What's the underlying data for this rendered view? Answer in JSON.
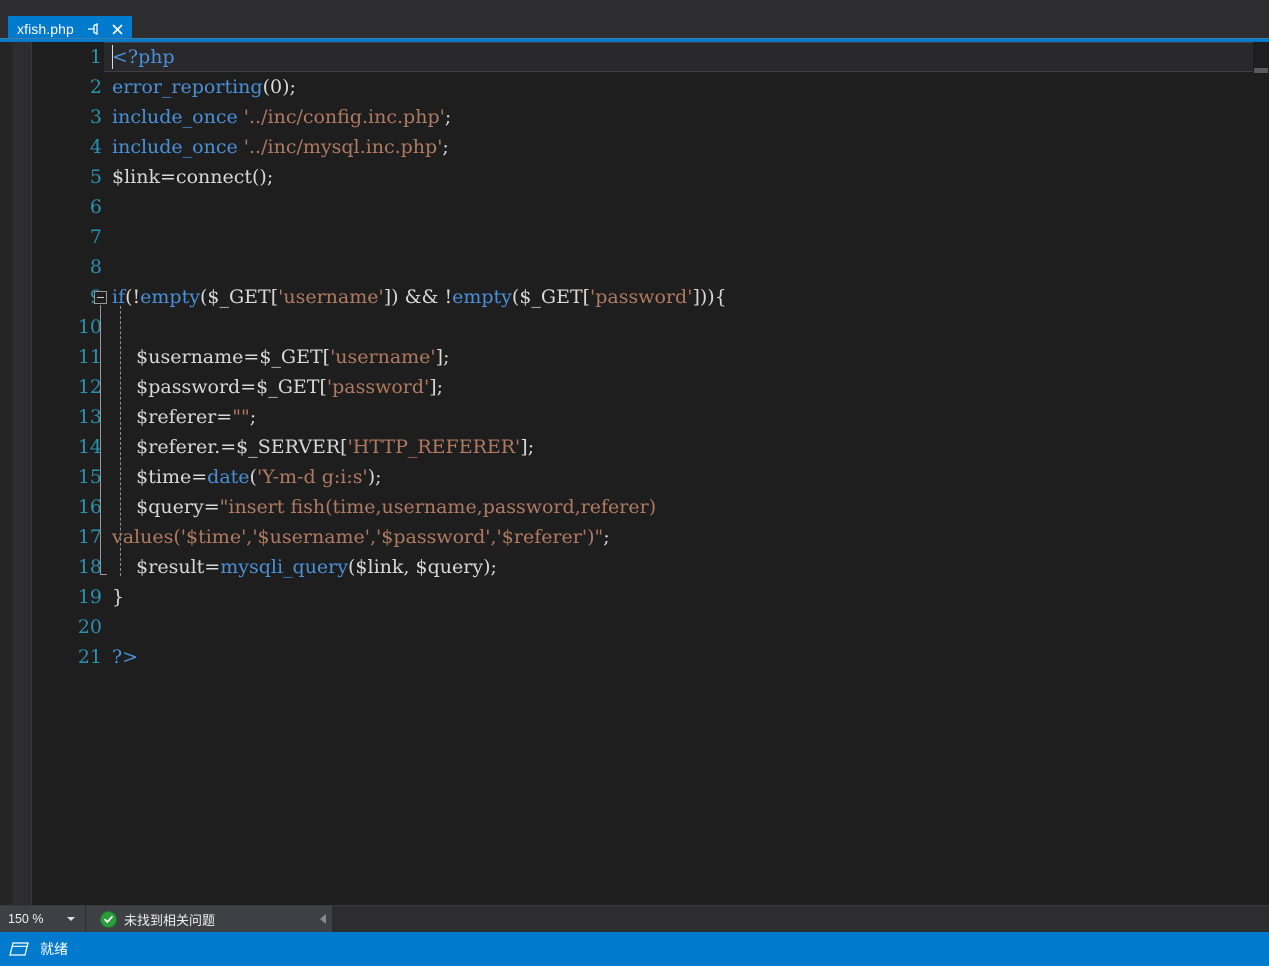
{
  "tab": {
    "title": "xfish.php",
    "pin_icon": "pin-icon",
    "close_icon": "close-icon"
  },
  "editor": {
    "caret_line": 1,
    "current_line": 1,
    "lines": [
      {
        "n": "1",
        "tokens": [
          {
            "t": "kw",
            "s": "<?php"
          }
        ]
      },
      {
        "n": "2",
        "tokens": [
          {
            "t": "fn",
            "s": "error_reporting"
          },
          {
            "t": "punc",
            "s": "("
          },
          {
            "t": "num",
            "s": "0"
          },
          {
            "t": "punc",
            "s": ");"
          }
        ]
      },
      {
        "n": "3",
        "tokens": [
          {
            "t": "fn",
            "s": "include_once"
          },
          {
            "t": "plain",
            "s": " "
          },
          {
            "t": "str",
            "s": "'../inc/config.inc.php'"
          },
          {
            "t": "punc",
            "s": ";"
          }
        ]
      },
      {
        "n": "4",
        "tokens": [
          {
            "t": "fn",
            "s": "include_once"
          },
          {
            "t": "plain",
            "s": " "
          },
          {
            "t": "str",
            "s": "'../inc/mysql.inc.php'"
          },
          {
            "t": "punc",
            "s": ";"
          }
        ]
      },
      {
        "n": "5",
        "tokens": [
          {
            "t": "var",
            "s": "$link"
          },
          {
            "t": "punc",
            "s": "="
          },
          {
            "t": "plain",
            "s": "connect"
          },
          {
            "t": "punc",
            "s": "();"
          }
        ]
      },
      {
        "n": "6",
        "tokens": []
      },
      {
        "n": "7",
        "tokens": []
      },
      {
        "n": "8",
        "tokens": []
      },
      {
        "n": "9",
        "tokens": [
          {
            "t": "kw",
            "s": "if"
          },
          {
            "t": "punc",
            "s": "(!"
          },
          {
            "t": "kw",
            "s": "empty"
          },
          {
            "t": "punc",
            "s": "("
          },
          {
            "t": "var",
            "s": "$_GET"
          },
          {
            "t": "punc",
            "s": "["
          },
          {
            "t": "str",
            "s": "'username'"
          },
          {
            "t": "punc",
            "s": "])"
          },
          {
            "t": "plain",
            "s": " && !"
          },
          {
            "t": "kw",
            "s": "empty"
          },
          {
            "t": "punc",
            "s": "("
          },
          {
            "t": "var",
            "s": "$_GET"
          },
          {
            "t": "punc",
            "s": "["
          },
          {
            "t": "str",
            "s": "'password'"
          },
          {
            "t": "punc",
            "s": "])){"
          }
        ]
      },
      {
        "n": "10",
        "tokens": []
      },
      {
        "n": "11",
        "tokens": [
          {
            "t": "plain",
            "s": "    "
          },
          {
            "t": "var",
            "s": "$username"
          },
          {
            "t": "punc",
            "s": "="
          },
          {
            "t": "var",
            "s": "$_GET"
          },
          {
            "t": "punc",
            "s": "["
          },
          {
            "t": "str",
            "s": "'username'"
          },
          {
            "t": "punc",
            "s": "];"
          }
        ]
      },
      {
        "n": "12",
        "tokens": [
          {
            "t": "plain",
            "s": "    "
          },
          {
            "t": "var",
            "s": "$password"
          },
          {
            "t": "punc",
            "s": "="
          },
          {
            "t": "var",
            "s": "$_GET"
          },
          {
            "t": "punc",
            "s": "["
          },
          {
            "t": "str",
            "s": "'password'"
          },
          {
            "t": "punc",
            "s": "];"
          }
        ]
      },
      {
        "n": "13",
        "tokens": [
          {
            "t": "plain",
            "s": "    "
          },
          {
            "t": "var",
            "s": "$referer"
          },
          {
            "t": "punc",
            "s": "="
          },
          {
            "t": "str",
            "s": "\"\""
          },
          {
            "t": "punc",
            "s": ";"
          }
        ]
      },
      {
        "n": "14",
        "tokens": [
          {
            "t": "plain",
            "s": "    "
          },
          {
            "t": "var",
            "s": "$referer"
          },
          {
            "t": "punc",
            "s": ".="
          },
          {
            "t": "var",
            "s": "$_SERVER"
          },
          {
            "t": "punc",
            "s": "["
          },
          {
            "t": "str",
            "s": "'HTTP_REFERER'"
          },
          {
            "t": "punc",
            "s": "];"
          }
        ]
      },
      {
        "n": "15",
        "tokens": [
          {
            "t": "plain",
            "s": "    "
          },
          {
            "t": "var",
            "s": "$time"
          },
          {
            "t": "punc",
            "s": "="
          },
          {
            "t": "fn",
            "s": "date"
          },
          {
            "t": "punc",
            "s": "("
          },
          {
            "t": "str",
            "s": "'Y-m-d g:i:s'"
          },
          {
            "t": "punc",
            "s": ");"
          }
        ]
      },
      {
        "n": "16",
        "tokens": [
          {
            "t": "plain",
            "s": "    "
          },
          {
            "t": "var",
            "s": "$query"
          },
          {
            "t": "punc",
            "s": "="
          },
          {
            "t": "str",
            "s": "\"insert fish(time,username,password,referer)"
          }
        ]
      },
      {
        "n": "17",
        "tokens": [
          {
            "t": "str",
            "s": "values('$time','$username','$password','$referer')\""
          },
          {
            "t": "punc",
            "s": ";"
          }
        ]
      },
      {
        "n": "18",
        "tokens": [
          {
            "t": "plain",
            "s": "    "
          },
          {
            "t": "var",
            "s": "$result"
          },
          {
            "t": "punc",
            "s": "="
          },
          {
            "t": "fn",
            "s": "mysqli_query"
          },
          {
            "t": "punc",
            "s": "("
          },
          {
            "t": "var",
            "s": "$link"
          },
          {
            "t": "punc",
            "s": ","
          },
          {
            "t": "plain",
            "s": " "
          },
          {
            "t": "var",
            "s": "$query"
          },
          {
            "t": "punc",
            "s": ");"
          }
        ]
      },
      {
        "n": "19",
        "tokens": [
          {
            "t": "punc",
            "s": "}"
          }
        ]
      },
      {
        "n": "20",
        "tokens": []
      },
      {
        "n": "21",
        "tokens": [
          {
            "t": "kw",
            "s": "?>"
          }
        ]
      }
    ]
  },
  "editbar": {
    "zoom_level": "150 %",
    "zoom_dropdown_icon": "chevron-down-icon",
    "status_icon": "check-circle-icon",
    "status_text": "未找到相关问题",
    "hscroll_left_icon": "triangle-left-icon"
  },
  "statusbar": {
    "icon": "window-icon",
    "text": "就绪"
  },
  "colors": {
    "accent": "#007acc",
    "editor_bg": "#1e1e1e",
    "chrome_bg": "#2d2d30",
    "linenumber": "#2b91af",
    "keyword": "#4a90d9",
    "string": "#b07a62",
    "plain_text": "#d8d8d8",
    "ok_green": "#2a9e3d"
  }
}
